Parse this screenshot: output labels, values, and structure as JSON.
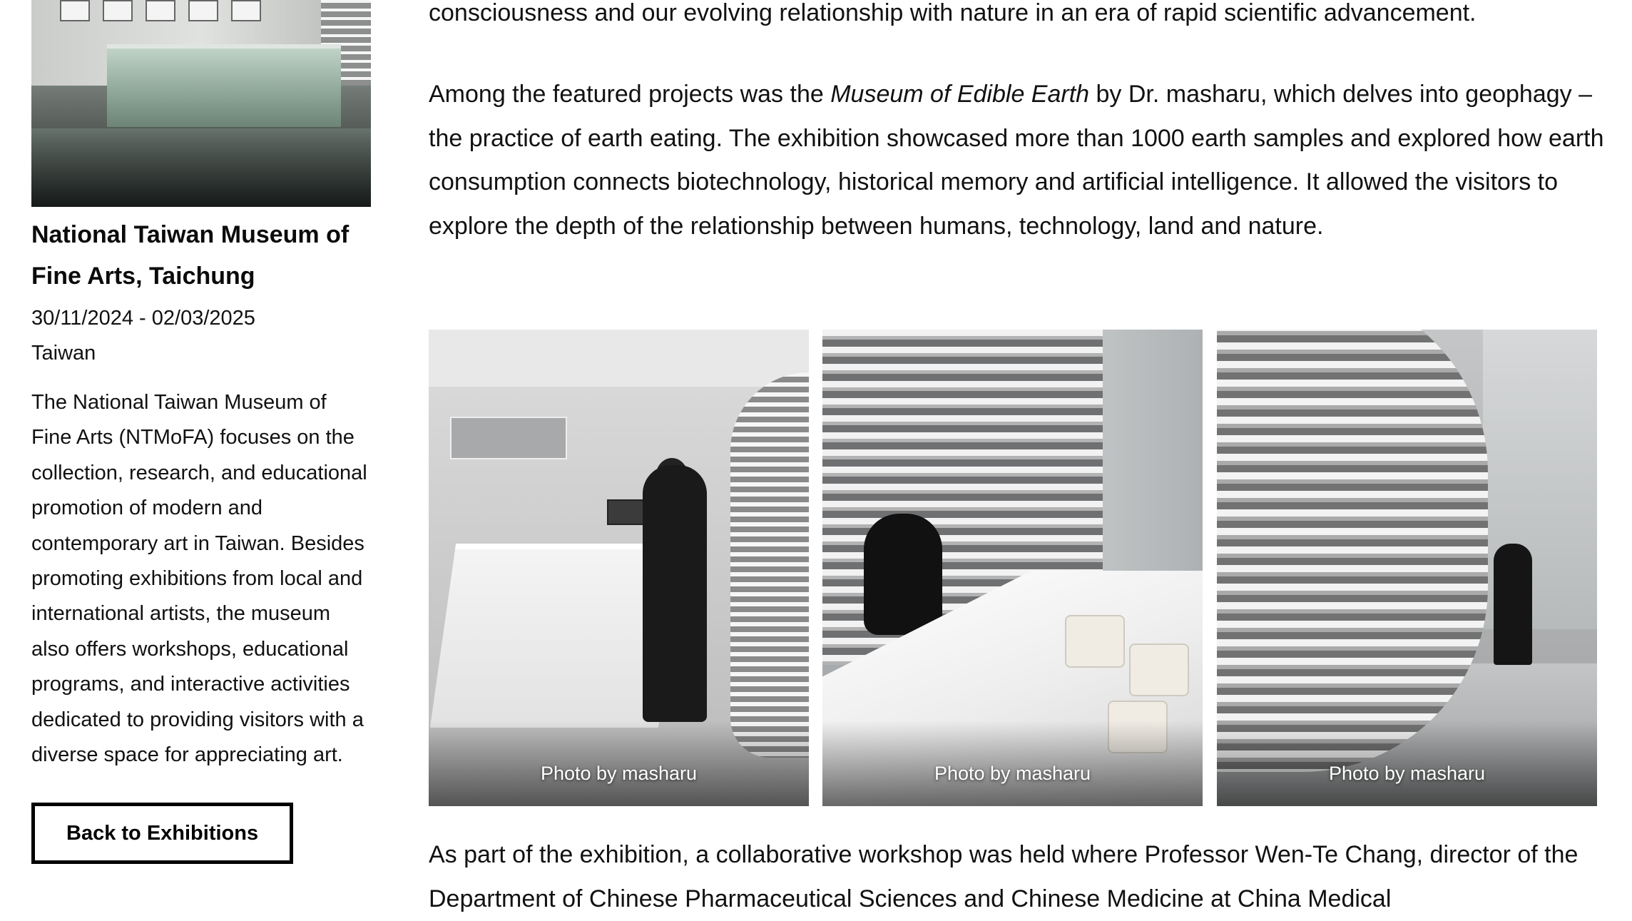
{
  "sidebar": {
    "venue_title": "National Taiwan Museum of Fine Arts, Taichung",
    "dates": "30/11/2024 - 02/03/2025",
    "country": "Taiwan",
    "description": "The National Taiwan Museum of Fine Arts (NTMoFA) focuses on the collection, research, and educational promotion of modern and contemporary art in Taiwan. Besides promoting exhibitions from local and international artists, the museum also offers workshops, educational programs, and interactive activities dedicated to providing visitors with a diverse space for appreciating art.",
    "back_button_label": "Back to Exhibitions"
  },
  "main": {
    "paragraph_top": "consciousness and our evolving relationship with nature in an era of rapid scientific advancement.",
    "paragraph_featured": {
      "before": "Among the featured projects was the ",
      "italic": "Museum of Edible Earth",
      "after": " by Dr. masharu, which delves into geophagy – the practice of earth eating. The exhibition showcased more than 1000 earth samples and explored how earth consumption connects biotechnology, historical memory and artificial intelligence. It allowed the visitors to explore the depth of the relationship between humans, technology, land and nature."
    },
    "photos": [
      {
        "caption": "Photo by masharu"
      },
      {
        "caption": "Photo by masharu"
      },
      {
        "caption": "Photo by masharu"
      }
    ],
    "paragraph_workshop": "As part of the exhibition, a collaborative workshop was held where Professor Wen-Te Chang, director of the Department of Chinese Pharmaceutical Sciences and Chinese Medicine at China Medical"
  }
}
